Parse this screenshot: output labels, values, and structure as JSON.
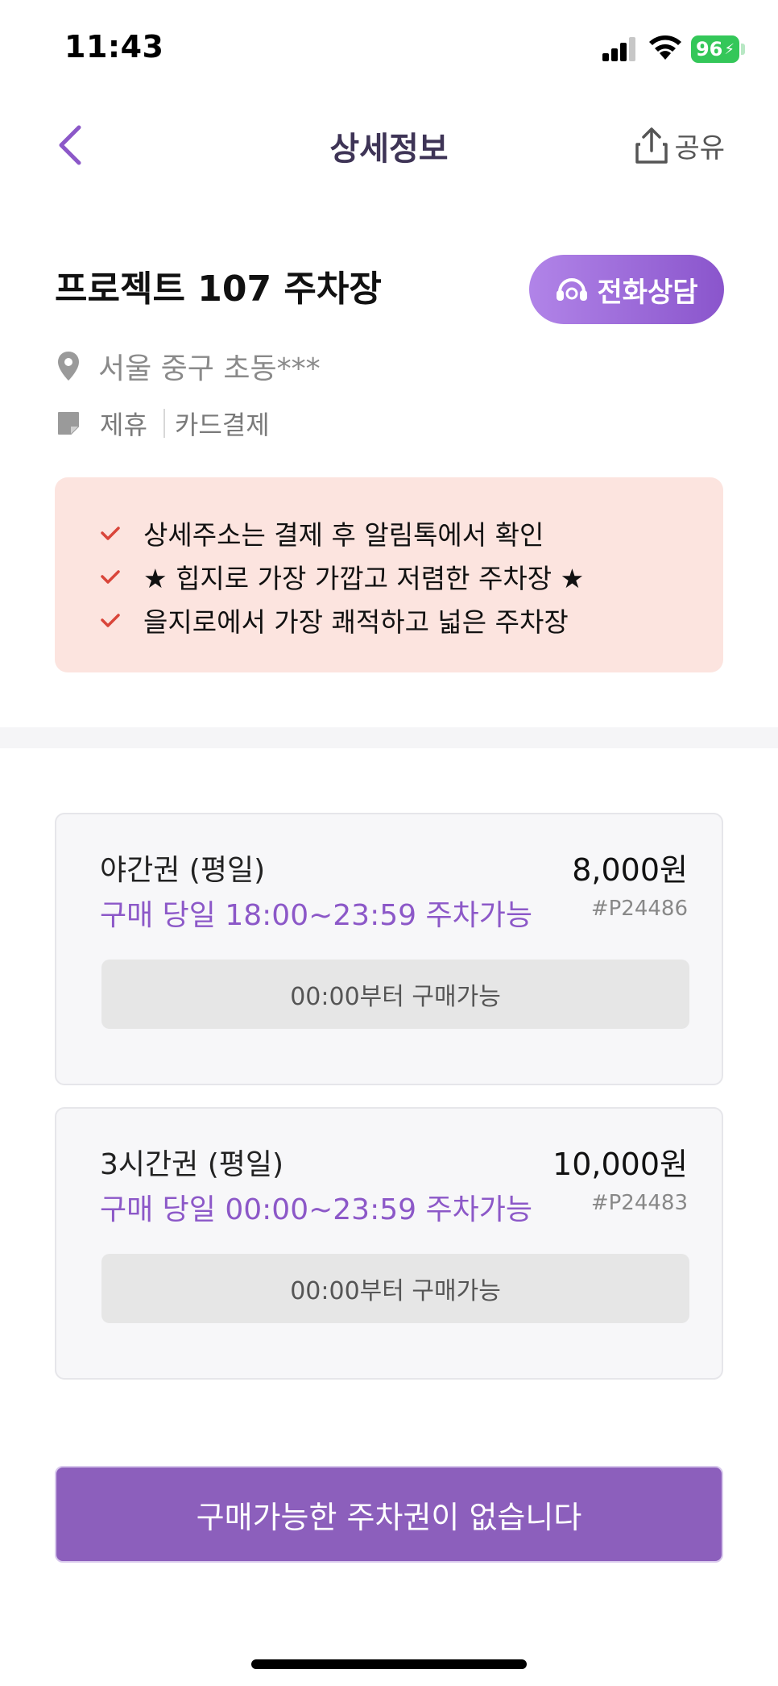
{
  "status_bar": {
    "time": "11:43",
    "battery": "96",
    "icons": [
      "signal-icon",
      "wifi-icon",
      "battery-icon"
    ]
  },
  "header": {
    "title": "상세정보",
    "back_icon": "chevron-left-icon",
    "share_label": "공유",
    "share_icon": "share-icon"
  },
  "lot": {
    "name": "프로젝트 107 주차장",
    "call_label": "전화상담",
    "call_icon": "headset-icon",
    "address": "서울 중구 초동***",
    "tags": [
      "제휴",
      "카드결제"
    ]
  },
  "notice": {
    "items": [
      "상세주소는 결제 후 알림톡에서 확인",
      "★ 힙지로 가장 가깝고 저렴한 주차장 ★",
      "을지로에서 가장 쾌적하고 넓은 주차장"
    ]
  },
  "tickets": [
    {
      "name": "야간권 (평일)",
      "price": "8,000원",
      "time": "구매 당일 18:00~23:59 주차가능",
      "code": "#P24486",
      "status": "00:00부터 구매가능"
    },
    {
      "name": "3시간권 (평일)",
      "price": "10,000원",
      "time": "구매 당일 00:00~23:59 주차가능",
      "code": "#P24483",
      "status": "00:00부터 구매가능"
    }
  ],
  "cta": {
    "label": "구매가능한 주차권이 없습니다"
  },
  "colors": {
    "accent": "#8c58c8",
    "notice_bg": "#fce4df",
    "check": "#d9453a",
    "title": "#3e3456"
  }
}
